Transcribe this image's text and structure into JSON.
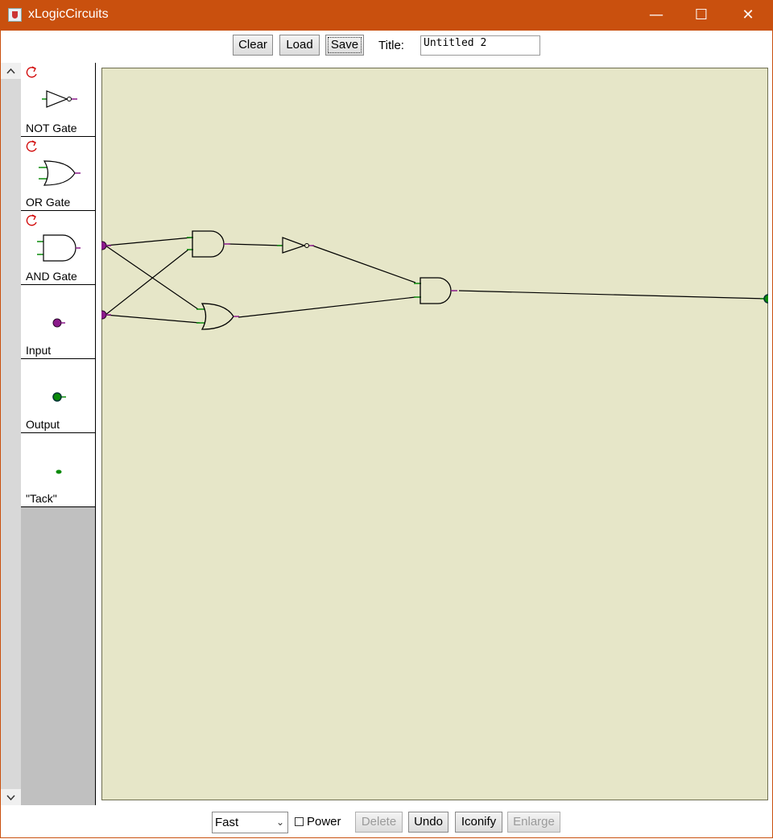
{
  "window": {
    "title": "xLogicCircuits",
    "controls": {
      "minimize": "—",
      "maximize": "☐",
      "close": "✕"
    }
  },
  "toolbar_top": {
    "clear_label": "Clear",
    "load_label": "Load",
    "save_label": "Save",
    "title_label": "Title:",
    "title_value": "Untitled 2"
  },
  "scrollbar": {
    "up": "^",
    "down": "v"
  },
  "palette": {
    "items": [
      {
        "label": "NOT Gate",
        "icon": "not-gate-icon",
        "rotate_icon": "rotate-icon"
      },
      {
        "label": "OR Gate",
        "icon": "or-gate-icon",
        "rotate_icon": "rotate-icon"
      },
      {
        "label": "AND Gate",
        "icon": "and-gate-icon",
        "rotate_icon": "rotate-icon"
      },
      {
        "label": "Input",
        "icon": "input-node-icon"
      },
      {
        "label": "Output",
        "icon": "output-node-icon"
      },
      {
        "label": "\"Tack\"",
        "icon": "tack-icon"
      }
    ]
  },
  "circuit": {
    "components": [
      "input-1",
      "input-2",
      "and-gate-1",
      "or-gate-1",
      "not-gate-1",
      "and-gate-2",
      "output-1"
    ]
  },
  "toolbar_bottom": {
    "speed_value": "Fast",
    "power_label": "Power",
    "power_checked": false,
    "delete_label": "Delete",
    "undo_label": "Undo",
    "iconify_label": "Iconify",
    "enlarge_label": "Enlarge"
  },
  "colors": {
    "titlebar": "#c9500e",
    "canvas": "#e6e6c8",
    "input_node": "#8b1a8b",
    "output_node": "#0a8a0a",
    "wire": "#000000",
    "rotate": "#d00000"
  }
}
